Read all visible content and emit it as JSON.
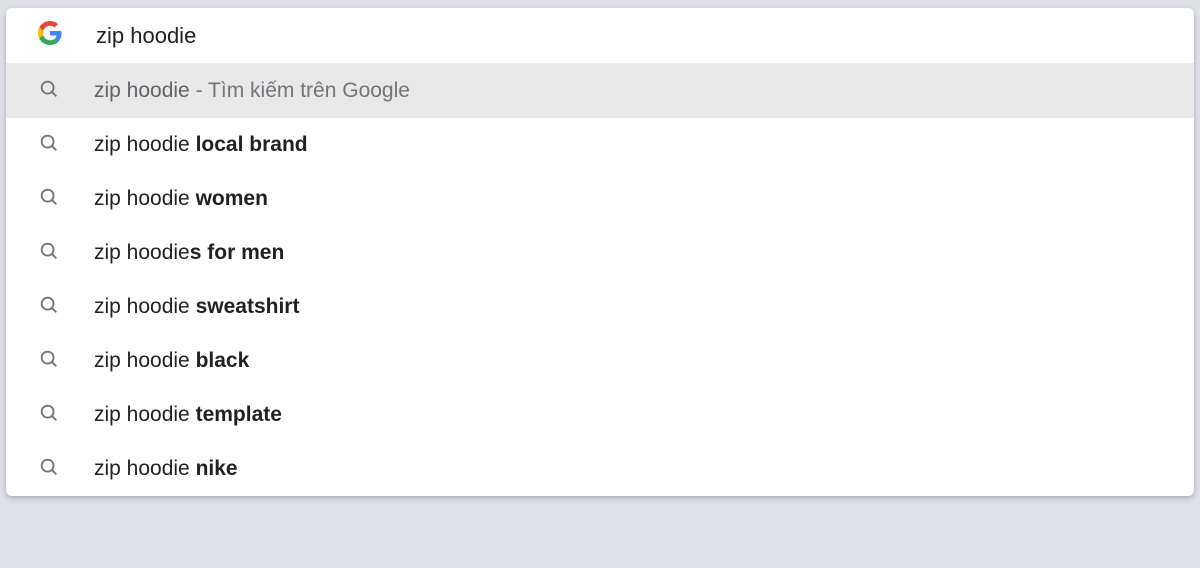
{
  "search": {
    "query": "zip hoodie",
    "google_search_suffix": "Tìm kiếm trên Google"
  },
  "suggestions": [
    {
      "prefix": "zip hoodie",
      "bold": "",
      "is_google_search": true,
      "highlighted": true
    },
    {
      "prefix": "zip hoodie ",
      "bold": "local brand",
      "is_google_search": false,
      "highlighted": false
    },
    {
      "prefix": "zip hoodie ",
      "bold": "women",
      "is_google_search": false,
      "highlighted": false
    },
    {
      "prefix": "zip hoodie",
      "bold": "s for men",
      "is_google_search": false,
      "highlighted": false
    },
    {
      "prefix": "zip hoodie ",
      "bold": "sweatshirt",
      "is_google_search": false,
      "highlighted": false
    },
    {
      "prefix": "zip hoodie ",
      "bold": "black",
      "is_google_search": false,
      "highlighted": false
    },
    {
      "prefix": "zip hoodie ",
      "bold": "template",
      "is_google_search": false,
      "highlighted": false
    },
    {
      "prefix": "zip hoodie ",
      "bold": "nike",
      "is_google_search": false,
      "highlighted": false
    }
  ]
}
